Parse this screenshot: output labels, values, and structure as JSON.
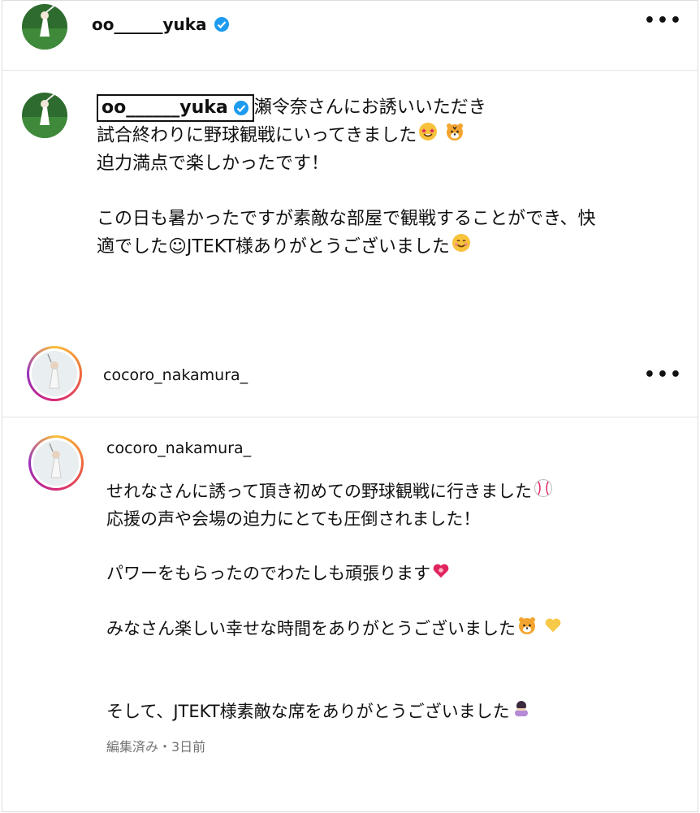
{
  "post1": {
    "header_username": "oo______yuka",
    "mention_username": "oo______yuka",
    "lines": [
      "瀬令奈さんにお誘いいただき",
      "試合終わりに野球観戦にいってきました",
      "迫力満点で楽しかったです！",
      "",
      "この日も暑かったですが素敵な部屋で観戦することができ、快",
      "適でした☺JTEKT様ありがとうございました"
    ],
    "icons": [
      "star-struck-emoji",
      "tiger-emoji",
      "smiling-emoji",
      "verified-badge-icon",
      "more-options-icon"
    ]
  },
  "post2": {
    "header_username": "cocoro_nakamura_",
    "caption_username": "cocoro_nakamura_",
    "lines": [
      "せれなさんに誘って頂き初めての野球観戦に行きました",
      "応援の声や会場の迫力にとても圧倒されました！",
      "",
      "パワーをもらったのでわたしも頑張ります",
      "",
      "みなさん楽しい幸せな時間をありがとうございました",
      "",
      "",
      "そして、JTEKT様素敵な席をありがとうございました"
    ],
    "meta": "編集済み・3日前",
    "icons": [
      "baseball-emoji",
      "heart-emoji",
      "tiger-emoji",
      "yellow-heart-emoji",
      "bowing-person-emoji",
      "more-options-icon"
    ]
  },
  "colors": {
    "verified": "#1d9bf0",
    "meta_text": "#737373"
  }
}
